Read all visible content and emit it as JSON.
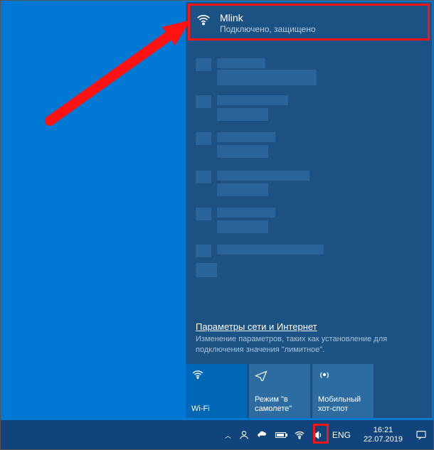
{
  "network": {
    "connected": {
      "name": "Mlink",
      "status": "Подключено, защищено"
    }
  },
  "settings": {
    "link": "Параметры сети и Интернет",
    "desc": "Изменение параметров, таких как установление для подключения значения \"лимитное\"."
  },
  "tiles": {
    "wifi": "Wi-Fi",
    "airplane": "Режим \"в самолете\"",
    "hotspot": "Мобильный хот-спот"
  },
  "tray": {
    "lang": "ENG",
    "time": "16:21",
    "date": "22.07.2019"
  }
}
